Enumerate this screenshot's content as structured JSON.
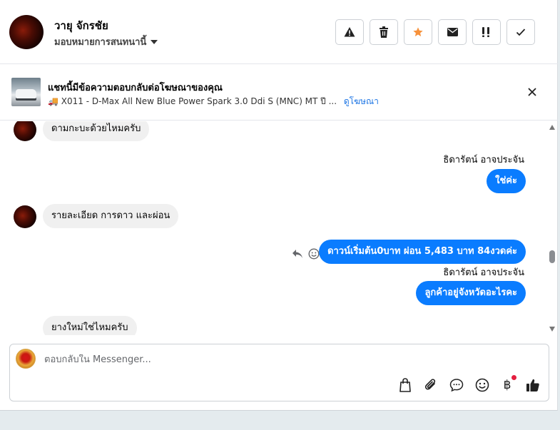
{
  "header": {
    "contact_name": "วายุ จักรชัย",
    "assign_label": "มอบหมายการสนทนานี้",
    "buttons": [
      "report",
      "delete",
      "star",
      "mark-unread",
      "spam",
      "done"
    ]
  },
  "ad_banner": {
    "title": "แชทนี้มีข้อความตอบกลับต่อโฆษณาของคุณ",
    "subtitle": "🚚 X011 - D-Max All New Blue Power Spark 3.0 Ddi S (MNC) MT ปี ...",
    "link": "ดูโฆษณา"
  },
  "messages": [
    {
      "direction": "in",
      "text": "ดามกะบะด้วยไหมครับ"
    },
    {
      "direction": "out",
      "sender": "ธิดารัตน์ อาจประจัน",
      "text": "ใช่ค่ะ"
    },
    {
      "direction": "in",
      "text": "รายละเอียด การดาว และผ่อน"
    },
    {
      "direction": "out",
      "text": "ดาวน์เริ่มต้น0บาท ผ่อน 5,483 บาท 84งวดค่ะ"
    },
    {
      "direction": "out",
      "sender": "ธิดารัตน์ อาจประจัน",
      "text": "ลูกค้าอยู่จังหวัดอะไรคะ"
    },
    {
      "direction": "in",
      "text": "ยางใหม่ใช่ไหมครับ"
    }
  ],
  "composer": {
    "placeholder": "ตอบกลับใน Messenger...",
    "tools": [
      "bag-icon",
      "attachment-icon",
      "saved-reply-icon",
      "emoji-icon",
      "baht-icon",
      "thumbs-up-icon"
    ],
    "baht_symbol": "฿"
  },
  "colors": {
    "accent": "#0a7cff",
    "star": "#f7923b",
    "notification": "#e41e3f"
  }
}
